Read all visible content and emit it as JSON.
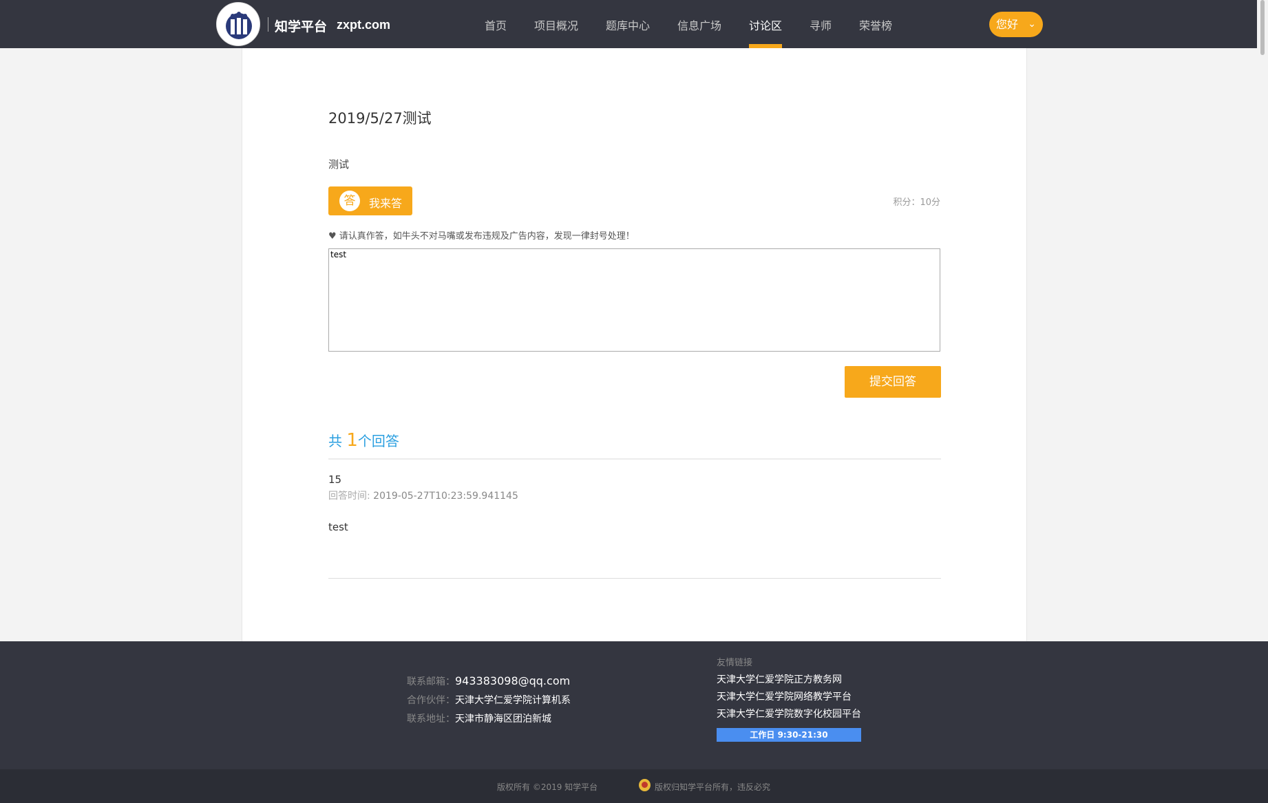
{
  "header": {
    "brand_name": "知学平台",
    "brand_domain": "zxpt.com",
    "nav": [
      "首页",
      "项目概况",
      "题库中心",
      "信息广场",
      "讨论区",
      "寻师",
      "荣誉榜"
    ],
    "active_nav": "讨论区",
    "greeting": "您好",
    "accent_color": "#f7a81b"
  },
  "question": {
    "title": "2019/5/27测试",
    "body": "测试",
    "answer_button": "我来答",
    "answer_icon_char": "答",
    "points": "积分：10分",
    "notice": "♥ 请认真作答，如牛头不对马嘴或发布违规及广告内容，发现一律封号处理！",
    "answer_input_value": "test",
    "submit_label": "提交回答"
  },
  "answers": {
    "count_prefix": "共",
    "count": "1",
    "count_suffix": "个回答",
    "items": [
      {
        "user": "15",
        "time_label": "回答时间:",
        "time": "2019-05-27T10:23:59.941145",
        "content": "test"
      }
    ]
  },
  "footer": {
    "contact": [
      {
        "key": "联系邮箱：",
        "value": "943383098@qq.com"
      },
      {
        "key": "合作伙伴：",
        "value": "天津大学仁爱学院计算机系"
      },
      {
        "key": "联系地址：",
        "value": "天津市静海区团泊新城"
      }
    ],
    "links_title": "友情链接",
    "links": [
      "天津大学仁爱学院正方教务网",
      "天津大学仁爱学院网络教学平台",
      "天津大学仁爱学院数字化校园平台"
    ],
    "work_hours": "工作日 9:30-21:30",
    "copyright_left": "版权所有 ©2019 知学平台",
    "copyright_right": "版权归知学平台所有，违反必究"
  }
}
